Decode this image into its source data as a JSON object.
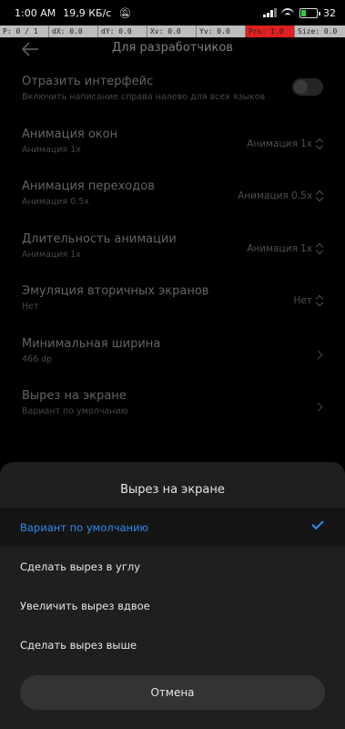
{
  "status_bar": {
    "time": "1:00 AM",
    "speed": "19,9 КБ/с",
    "battery": "32"
  },
  "pointer_bar": [
    "P: 0 / 1",
    "dX: 0.0",
    "dY: 0.0",
    "Xv: 0.0",
    "Yv: 0.0",
    "Prs: 1.0",
    "Size: 0.0"
  ],
  "app_bar": {
    "title": "Для разработчиков"
  },
  "settings": [
    {
      "title": "Отразить интерфейс",
      "subtitle": "Включить написание справа налево для всех языков",
      "type": "toggle"
    },
    {
      "title": "Анимация окон",
      "subtitle": "Анимация 1x",
      "value": "Анимация 1x",
      "type": "select"
    },
    {
      "title": "Анимация переходов",
      "subtitle": "Анимация 0.5x",
      "value": "Анимация 0.5x",
      "type": "select"
    },
    {
      "title": "Длительность анимации",
      "subtitle": "Анимация 1x",
      "value": "Анимация 1x",
      "type": "select"
    },
    {
      "title": "Эмуляция вторичных экранов",
      "subtitle": "Нет",
      "value": "Нет",
      "type": "select"
    },
    {
      "title": "Минимальная ширина",
      "subtitle": "466 dp",
      "type": "link"
    },
    {
      "title": "Вырез на экране",
      "subtitle": "Вариант по умолчанию",
      "type": "link"
    }
  ],
  "sheet": {
    "title": "Вырез на экране",
    "options": [
      {
        "label": "Вариант по умолчанию"
      },
      {
        "label": "Сделать вырез в углу"
      },
      {
        "label": "Увеличить вырез вдвое"
      },
      {
        "label": "Сделать вырез выше"
      }
    ],
    "selected_index": 0,
    "cancel_label": "Отмена"
  }
}
